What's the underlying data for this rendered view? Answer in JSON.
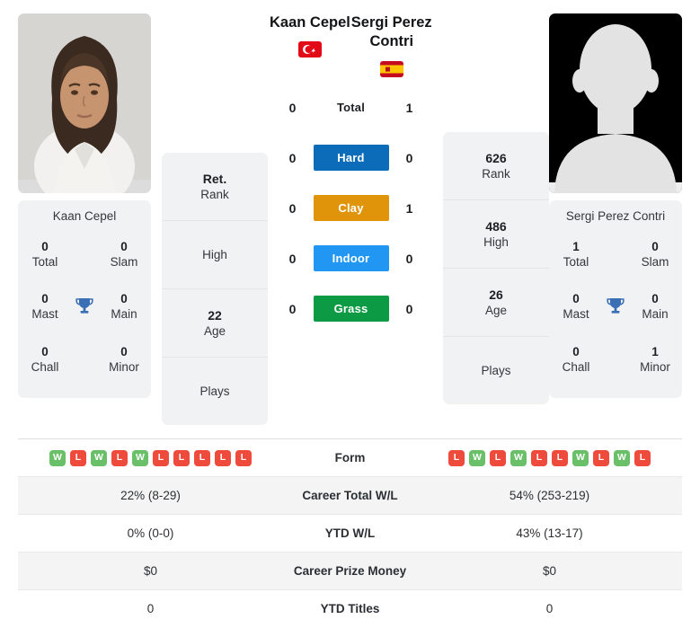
{
  "players": {
    "left": {
      "name": "Kaan Cepel",
      "flag": "turkey-flag",
      "photo": "player-portrait-photo",
      "card_name": "Kaan Cepel",
      "titles": {
        "total_value": "0",
        "total_label": "Total",
        "slam_value": "0",
        "slam_label": "Slam",
        "mast_value": "0",
        "mast_label": "Mast",
        "main_value": "0",
        "main_label": "Main",
        "chall_value": "0",
        "chall_label": "Chall",
        "minor_value": "0",
        "minor_label": "Minor"
      },
      "ranks": {
        "rank_value": "Ret.",
        "rank_label": "Rank",
        "high_value": "",
        "high_label": "High",
        "age_value": "22",
        "age_label": "Age",
        "plays_value": "",
        "plays_label": "Plays"
      },
      "surface_scores": {
        "total": "0",
        "hard": "0",
        "clay": "0",
        "indoor": "0",
        "grass": "0"
      },
      "form": [
        "W",
        "L",
        "W",
        "L",
        "W",
        "L",
        "L",
        "L",
        "L",
        "L"
      ],
      "table": {
        "career_wl": "22% (8-29)",
        "ytd_wl": "0% (0-0)",
        "career_prize": "$0",
        "ytd_titles": "0"
      }
    },
    "right": {
      "name": "Sergi Perez Contri",
      "flag": "spain-flag",
      "photo": "player-silhouette-placeholder",
      "card_name": "Sergi Perez Contri",
      "titles": {
        "total_value": "1",
        "total_label": "Total",
        "slam_value": "0",
        "slam_label": "Slam",
        "mast_value": "0",
        "mast_label": "Mast",
        "main_value": "0",
        "main_label": "Main",
        "chall_value": "0",
        "chall_label": "Chall",
        "minor_value": "1",
        "minor_label": "Minor"
      },
      "ranks": {
        "rank_value": "626",
        "rank_label": "Rank",
        "high_value": "486",
        "high_label": "High",
        "age_value": "26",
        "age_label": "Age",
        "plays_value": "",
        "plays_label": "Plays"
      },
      "surface_scores": {
        "total": "1",
        "hard": "0",
        "clay": "1",
        "indoor": "0",
        "grass": "0"
      },
      "form": [
        "L",
        "W",
        "L",
        "W",
        "L",
        "L",
        "W",
        "L",
        "W",
        "L"
      ],
      "table": {
        "career_wl": "54% (253-219)",
        "ytd_wl": "43% (13-17)",
        "career_prize": "$0",
        "ytd_titles": "0"
      }
    }
  },
  "surfaces": [
    {
      "key": "total",
      "label": "Total",
      "color": "transparent",
      "plain": true
    },
    {
      "key": "hard",
      "label": "Hard",
      "color": "#0c6cba",
      "plain": false
    },
    {
      "key": "clay",
      "label": "Clay",
      "color": "#e09409",
      "plain": false
    },
    {
      "key": "indoor",
      "label": "Indoor",
      "color": "#2196f3",
      "plain": false
    },
    {
      "key": "grass",
      "label": "Grass",
      "color": "#0d9a44",
      "plain": false
    }
  ],
  "table_labels": {
    "form": "Form",
    "career_wl": "Career Total W/L",
    "ytd_wl": "YTD W/L",
    "career_prize": "Career Prize Money",
    "ytd_titles": "YTD Titles"
  },
  "colors": {
    "win_badge": "#6abf69",
    "loss_badge": "#ef4b3c",
    "hard": "#0c6cba",
    "clay": "#e09409",
    "indoor": "#2196f3",
    "grass": "#0d9a44",
    "card_bg": "#f1f2f3",
    "trophy": "#3a6fb5"
  }
}
